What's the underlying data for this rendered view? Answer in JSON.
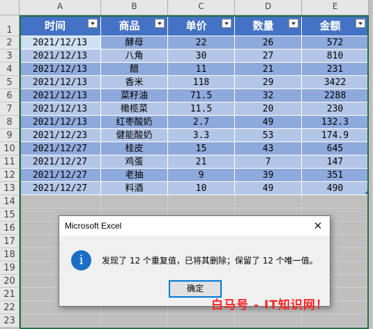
{
  "columns": [
    "A",
    "B",
    "C",
    "D",
    "E"
  ],
  "row_numbers": [
    "1",
    "2",
    "3",
    "4",
    "5",
    "6",
    "7",
    "8",
    "9",
    "10",
    "11",
    "12",
    "13",
    "14",
    "15",
    "16",
    "17",
    "18",
    "19",
    "20",
    "21",
    "22",
    "23"
  ],
  "table": {
    "headers": [
      "时间",
      "商品",
      "单价",
      "数量",
      "金额"
    ],
    "rows": [
      [
        "2021/12/13",
        "酵母",
        "22",
        "26",
        "572"
      ],
      [
        "2021/12/13",
        "八角",
        "30",
        "27",
        "810"
      ],
      [
        "2021/12/13",
        "醋",
        "11",
        "21",
        "231"
      ],
      [
        "2021/12/13",
        "香米",
        "118",
        "29",
        "3422"
      ],
      [
        "2021/12/13",
        "菜籽油",
        "71.5",
        "32",
        "2288"
      ],
      [
        "2021/12/13",
        "橄榄菜",
        "11.5",
        "20",
        "230"
      ],
      [
        "2021/12/13",
        "红枣酸奶",
        "2.7",
        "49",
        "132.3"
      ],
      [
        "2021/12/23",
        "健能酸奶",
        "3.3",
        "53",
        "174.9"
      ],
      [
        "2021/12/27",
        "桂皮",
        "15",
        "43",
        "645"
      ],
      [
        "2021/12/27",
        "鸡蛋",
        "21",
        "7",
        "147"
      ],
      [
        "2021/12/27",
        "老抽",
        "9",
        "39",
        "351"
      ],
      [
        "2021/12/27",
        "料酒",
        "10",
        "49",
        "490"
      ]
    ]
  },
  "colors": {
    "header_fill": "#4472c4",
    "band_dark": "#8ea9db",
    "band_light": "#b4c6e7",
    "selected_cell": "#cfe0f3",
    "selection_border": "#1e7145",
    "watermark": "#ff2323"
  },
  "dialog": {
    "title": "Microsoft Excel",
    "close_glyph": "✕",
    "icon": "info-icon",
    "icon_glyph": "i",
    "message": "发现了 12 个重复值，已将其删除；保留了 12 个唯一值。",
    "ok_label": "确定"
  },
  "watermark": "白马号 - IT知识网！"
}
